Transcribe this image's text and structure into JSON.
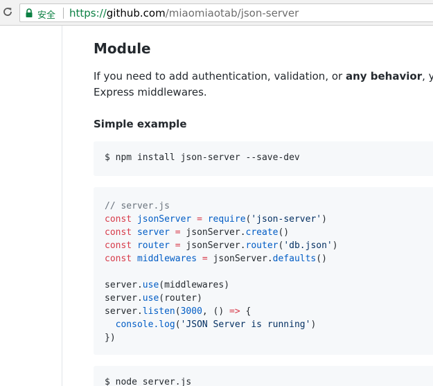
{
  "browser": {
    "secure_label": "安全",
    "url_scheme": "https://",
    "url_host": "github.com",
    "url_path": "/miaomiaotab/json-server"
  },
  "doc": {
    "heading": "Module",
    "para_part1": "If you need to add authentication, validation, or ",
    "para_bold": "any behavior",
    "para_part2": ", you can",
    "para_line2": "Express middlewares.",
    "subheading": "Simple example",
    "install_command": "$ npm install json-server --save-dev",
    "run_command": "$ node server.js"
  },
  "code": {
    "l1_comment": "// server.js",
    "l2_kw": "const",
    "l2_var": "jsonServer",
    "l2_op": "=",
    "l2_fn": "require",
    "l2_p1": "(",
    "l2_str": "'json-server'",
    "l2_p2": ")",
    "l3_kw": "const",
    "l3_var": "server",
    "l3_op": "=",
    "l3_obj": "jsonServer.",
    "l3_fn": "create",
    "l3_p": "()",
    "l4_kw": "const",
    "l4_var": "router",
    "l4_op": "=",
    "l4_obj": "jsonServer.",
    "l4_fn": "router",
    "l4_p1": "(",
    "l4_str": "'db.json'",
    "l4_p2": ")",
    "l5_kw": "const",
    "l5_var": "middlewares",
    "l5_op": "=",
    "l5_obj": "jsonServer.",
    "l5_fn": "defaults",
    "l5_p": "()",
    "l7_obj": "server.",
    "l7_fn": "use",
    "l7_rest": "(middlewares)",
    "l8_obj": "server.",
    "l8_fn": "use",
    "l8_rest": "(router)",
    "l9_obj": "server.",
    "l9_fn": "listen",
    "l9_p1": "(",
    "l9_num": "3000",
    "l9_p2": ", () ",
    "l9_arrow": "=>",
    "l9_p3": " {",
    "l10_indent": "  ",
    "l10_obj": "console.",
    "l10_fn": "log",
    "l10_p1": "(",
    "l10_str": "'JSON Server is running'",
    "l10_p2": ")",
    "l11": "})"
  },
  "colors": {
    "secure_green": "#0b8043",
    "keyword": "#d73a49",
    "entity": "#005cc5",
    "string": "#032f62",
    "comment": "#6a737d",
    "code_bg": "#f6f8fa"
  },
  "icons": {
    "reload": "reload-icon",
    "lock": "lock-icon"
  }
}
